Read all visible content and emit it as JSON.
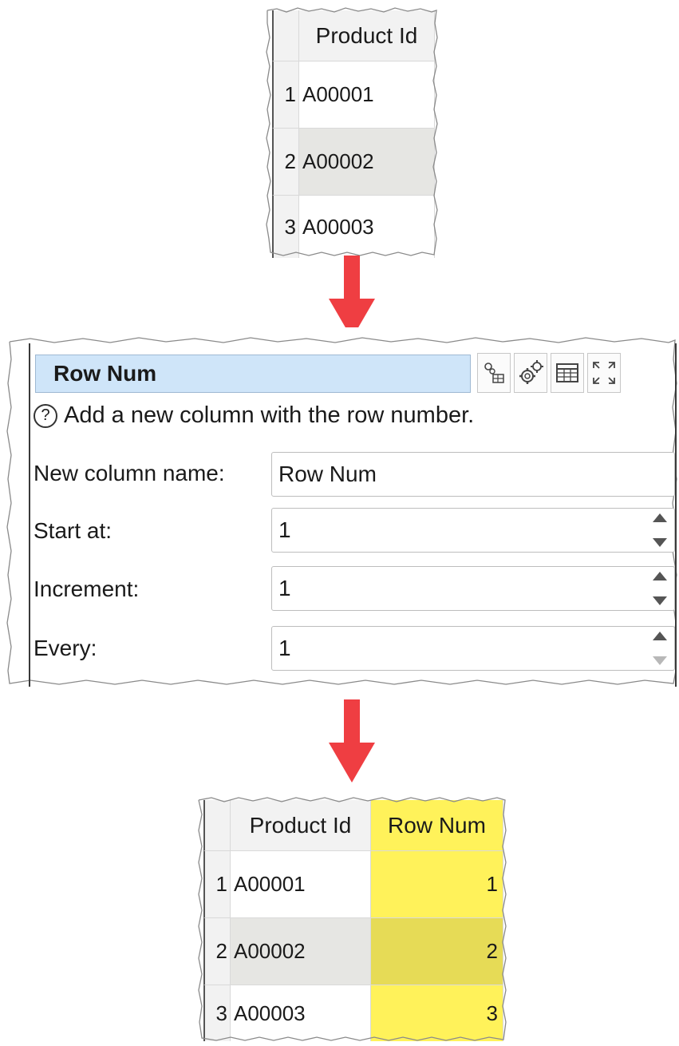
{
  "input_table": {
    "header": "Product Id",
    "rows": [
      {
        "num": "1",
        "value": "A00001"
      },
      {
        "num": "2",
        "value": "A00002"
      },
      {
        "num": "3",
        "value": "A00003"
      }
    ]
  },
  "dialog": {
    "title": "Row Num",
    "toolbar_icons": [
      "connection-settings-icon",
      "gears-icon",
      "table-icon",
      "maximize-icon"
    ],
    "help_icon": "?",
    "help_text": "Add a new column with the row number.",
    "fields": {
      "new_column_name": {
        "label": "New column name:",
        "value": "Row Num"
      },
      "start_at": {
        "label": "Start at:",
        "value": "1"
      },
      "increment": {
        "label": "Increment:",
        "value": "1"
      },
      "every": {
        "label": "Every:",
        "value": "1"
      }
    }
  },
  "output_table": {
    "headers": [
      "Product Id",
      "Row Num"
    ],
    "rows": [
      {
        "num": "1",
        "product": "A00001",
        "rownum": "1"
      },
      {
        "num": "2",
        "product": "A00002",
        "rownum": "2"
      },
      {
        "num": "3",
        "product": "A00003",
        "rownum": "3"
      }
    ]
  },
  "colors": {
    "arrow": "#ef3e42",
    "highlight_column": "#fff25a",
    "title_field": "#cfe5f9"
  }
}
